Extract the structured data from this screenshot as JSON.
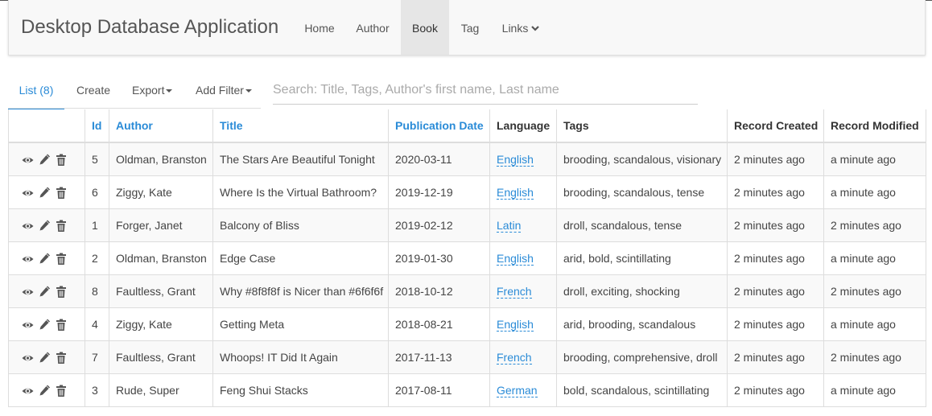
{
  "app": {
    "title": "Desktop Database Application"
  },
  "nav": {
    "home": "Home",
    "author": "Author",
    "book": "Book",
    "tag": "Tag",
    "links": "Links"
  },
  "tabs": {
    "list": "List (8)",
    "create": "Create",
    "export": "Export",
    "add_filter": "Add Filter"
  },
  "search": {
    "placeholder": "Search: Title, Tags, Author's first name, Last name",
    "value": ""
  },
  "table": {
    "headers": {
      "id": "Id",
      "author": "Author",
      "title": "Title",
      "pubdate": "Publication Date",
      "language": "Language",
      "tags": "Tags",
      "created": "Record Created",
      "modified": "Record Modified"
    },
    "rows": [
      {
        "id": "5",
        "author": "Oldman, Branston",
        "title": "The Stars Are Beautiful Tonight",
        "pubdate": "2020-03-11",
        "language": "English",
        "tags": "brooding, scandalous, visionary",
        "created": "2 minutes ago",
        "modified": "a minute ago"
      },
      {
        "id": "6",
        "author": "Ziggy, Kate",
        "title": "Where Is the Virtual Bathroom?",
        "pubdate": "2019-12-19",
        "language": "English",
        "tags": "brooding, scandalous, tense",
        "created": "2 minutes ago",
        "modified": "a minute ago"
      },
      {
        "id": "1",
        "author": "Forger, Janet",
        "title": "Balcony of Bliss",
        "pubdate": "2019-02-12",
        "language": "Latin",
        "tags": "droll, scandalous, tense",
        "created": "2 minutes ago",
        "modified": "2 minutes ago"
      },
      {
        "id": "2",
        "author": "Oldman, Branston",
        "title": "Edge Case",
        "pubdate": "2019-01-30",
        "language": "English",
        "tags": "arid, bold, scintillating",
        "created": "2 minutes ago",
        "modified": "a minute ago"
      },
      {
        "id": "8",
        "author": "Faultless, Grant",
        "title": "Why #8f8f8f is Nicer than #6f6f6f",
        "pubdate": "2018-10-12",
        "language": "French",
        "tags": "droll, exciting, shocking",
        "created": "2 minutes ago",
        "modified": "2 minutes ago"
      },
      {
        "id": "4",
        "author": "Ziggy, Kate",
        "title": "Getting Meta",
        "pubdate": "2018-08-21",
        "language": "English",
        "tags": "arid, brooding, scandalous",
        "created": "2 minutes ago",
        "modified": "a minute ago"
      },
      {
        "id": "7",
        "author": "Faultless, Grant",
        "title": "Whoops! IT Did It Again",
        "pubdate": "2017-11-13",
        "language": "French",
        "tags": "brooding, comprehensive, droll",
        "created": "2 minutes ago",
        "modified": "2 minutes ago"
      },
      {
        "id": "3",
        "author": "Rude, Super",
        "title": "Feng Shui Stacks",
        "pubdate": "2017-08-11",
        "language": "German",
        "tags": "bold, scandalous, scintillating",
        "created": "2 minutes ago",
        "modified": "a minute ago"
      }
    ]
  },
  "icons": {
    "view": "eye-icon",
    "edit": "pencil-icon",
    "delete": "trash-icon",
    "links_chevron": "chevron-down-icon"
  },
  "colors": {
    "accent": "#2a8bd7",
    "navbar_bg": "#f8f8f8",
    "active_nav_bg": "#e6e6e6"
  }
}
